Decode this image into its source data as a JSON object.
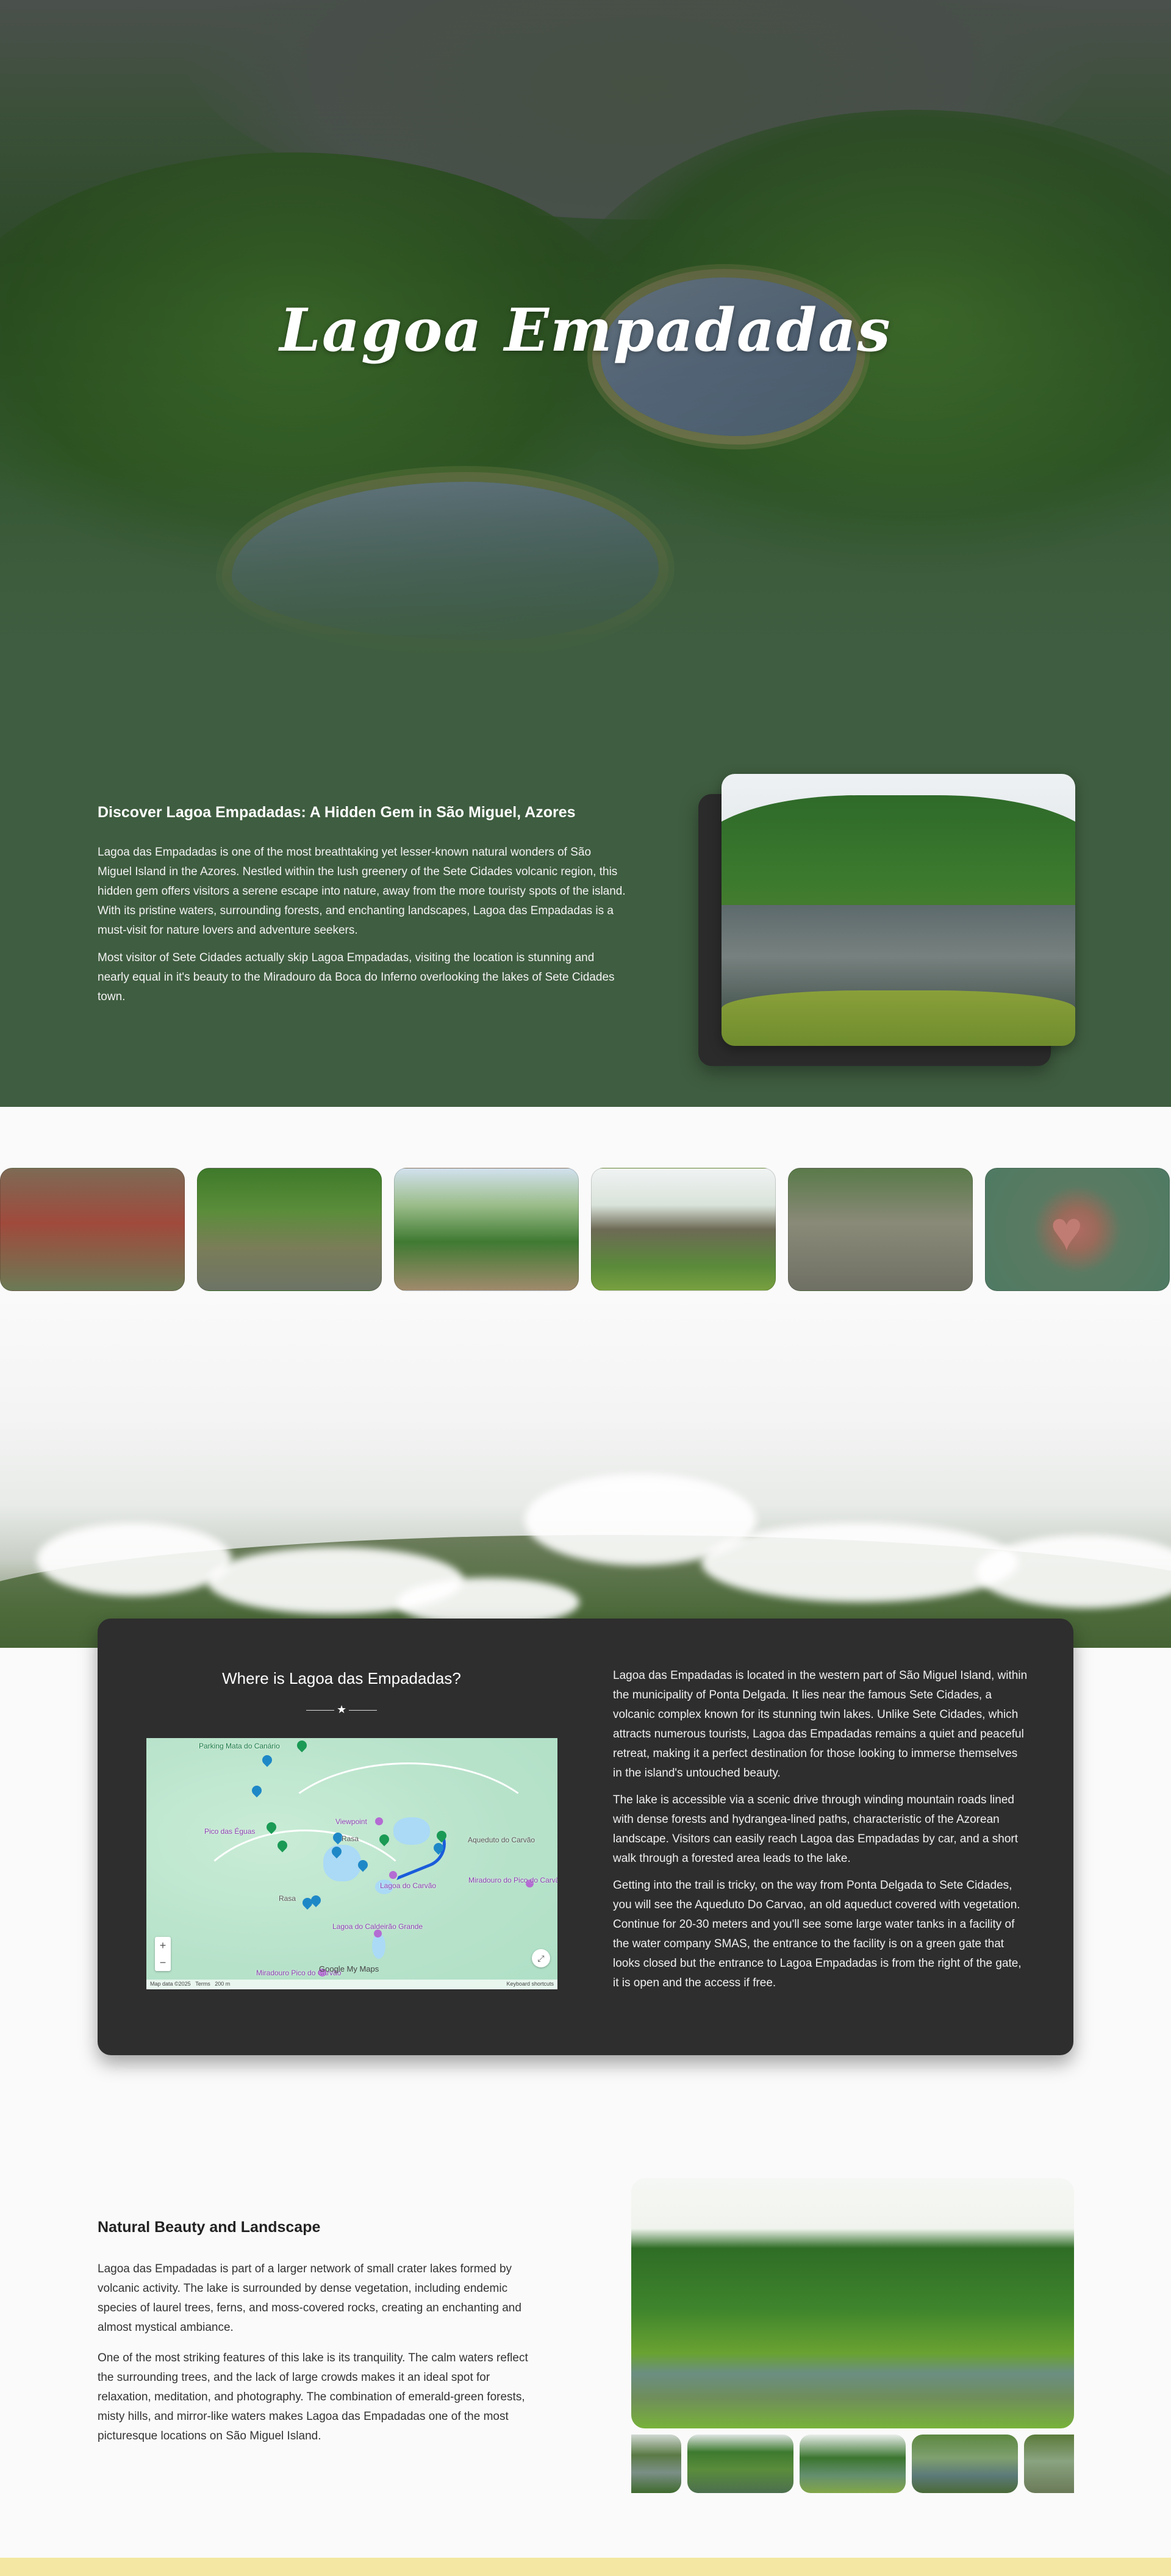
{
  "hero": {
    "title": "Lagoa Empadadas"
  },
  "discover": {
    "heading": "Discover Lagoa Empadadas: A Hidden Gem in São Miguel, Azores",
    "paragraph_1": "Lagoa das Empadadas is one of the most breathtaking yet lesser-known natural wonders of São Miguel Island in the Azores. Nestled within the lush greenery of the Sete Cidades volcanic region, this hidden gem offers visitors a serene escape into nature, away from the more touristy spots of the island. With its pristine waters, surrounding forests, and enchanting landscapes, Lagoa das Empadadas is a must-visit for nature lovers and adventure seekers.",
    "paragraph_2": "Most visitor of Sete Cidades actually skip Lagoa Empadadas, visiting the location is stunning and nearly equal in it's beauty to the Miradouro da Boca do Inferno overlooking the lakes of Sete Cidades town."
  },
  "where": {
    "heading": "Where is Lagoa das Empadadas?",
    "divider_icon": "star-icon",
    "map": {
      "labels": {
        "parking": "Parking Mata do Canário",
        "pico_eguas": "Pico das Éguas",
        "viewpoint": "Viewpoint",
        "aqueduto": "Aqueduto do Carvão",
        "rasa_1": "Rasa",
        "rasa_2": "Rasa",
        "lagoa_carvao": "Lagoa do Carvão",
        "miradouro_pico": "Miradouro do Pico do Carvão",
        "lagoa_caldeirao": "Lagoa do Caldeirão Grande",
        "miradouro_pico_carvao": "Miradouro Pico do Carvão",
        "google": "Google My Maps",
        "map_data": "Map data ©2025",
        "terms": "Terms",
        "scale": "200 m",
        "shortcuts": "Keyboard shortcuts",
        "zoom_in": "+",
        "zoom_out": "−"
      }
    },
    "paragraph_1": "Lagoa das Empadadas is located in the western part of São Miguel Island, within the municipality of Ponta Delgada. It lies near the famous Sete Cidades, a volcanic complex known for its stunning twin lakes. Unlike Sete Cidades, which attracts numerous tourists, Lagoa das Empadadas remains a quiet and peaceful retreat, making it a perfect destination for those looking to immerse themselves in the island's untouched beauty.",
    "paragraph_2": "The lake is accessible via a scenic drive through winding mountain roads lined with dense forests and hydrangea-lined paths, characteristic of the Azorean landscape. Visitors can easily reach Lagoa das Empadadas by car, and a short walk through a forested area leads to the lake.",
    "paragraph_3": "Getting into the trail is tricky, on the way from Ponta Delgada to Sete Cidades, you will see the Aqueduto Do Carvao, an old aqueduct covered with vegetation. Continue for 20-30 meters and you'll see some large water tanks in a facility of the water company SMAS, the entrance to the facility is on a green gate that looks closed but the entrance to Lagoa Empadadas is from the right of the gate, it is open and the access if free."
  },
  "natural": {
    "heading": "Natural Beauty and Landscape",
    "paragraph_1": "Lagoa das Empadadas is part of a larger network of small crater lakes formed by volcanic activity. The lake is surrounded by dense vegetation, including endemic species of laurel trees, ferns, and moss-covered rocks, creating an enchanting and almost mystical ambiance.",
    "paragraph_2": "One of the most striking features of this lake is its tranquility. The calm waters reflect the surrounding trees, and the lack of large crowds makes it an ideal spot for relaxation, meditation, and photography. The combination of emerald-green forests, misty hills, and mirror-like waters makes Lagoa das Empadadas one of the most picturesque locations on São Miguel Island."
  }
}
